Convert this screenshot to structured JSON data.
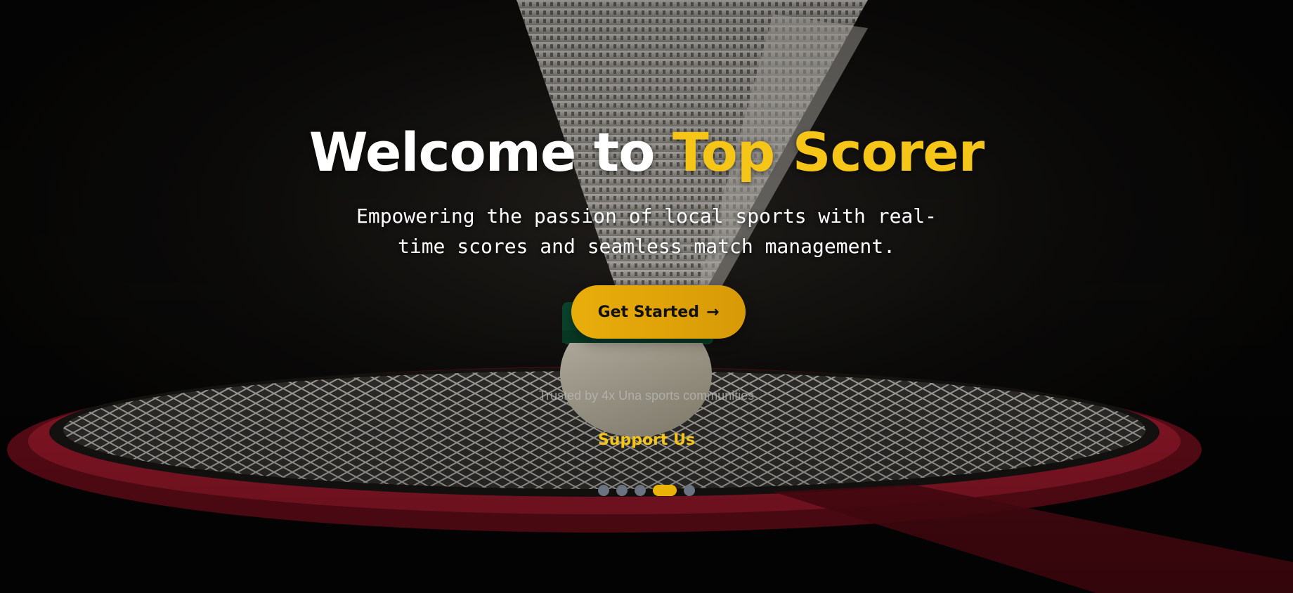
{
  "hero": {
    "title_main": "Welcome to ",
    "title_accent": "Top Scorer",
    "subtitle": "Empowering the passion of local sports with real-time scores and seamless match management.",
    "cta_label": "Get Started",
    "cta_icon": "arrow-right-icon",
    "cta_arrow": "→",
    "trusted_text": "Trusted by 4x Una sports communities",
    "support_label": "Support Us",
    "background": "badminton-shuttlecock-on-racket"
  },
  "carousel": {
    "slide_count": 5,
    "active_index": 3
  },
  "colors": {
    "accent": "#f5c518",
    "button": "#e9ad0b",
    "dot_inactive": "#6b7280",
    "dot_active": "#eab308"
  }
}
